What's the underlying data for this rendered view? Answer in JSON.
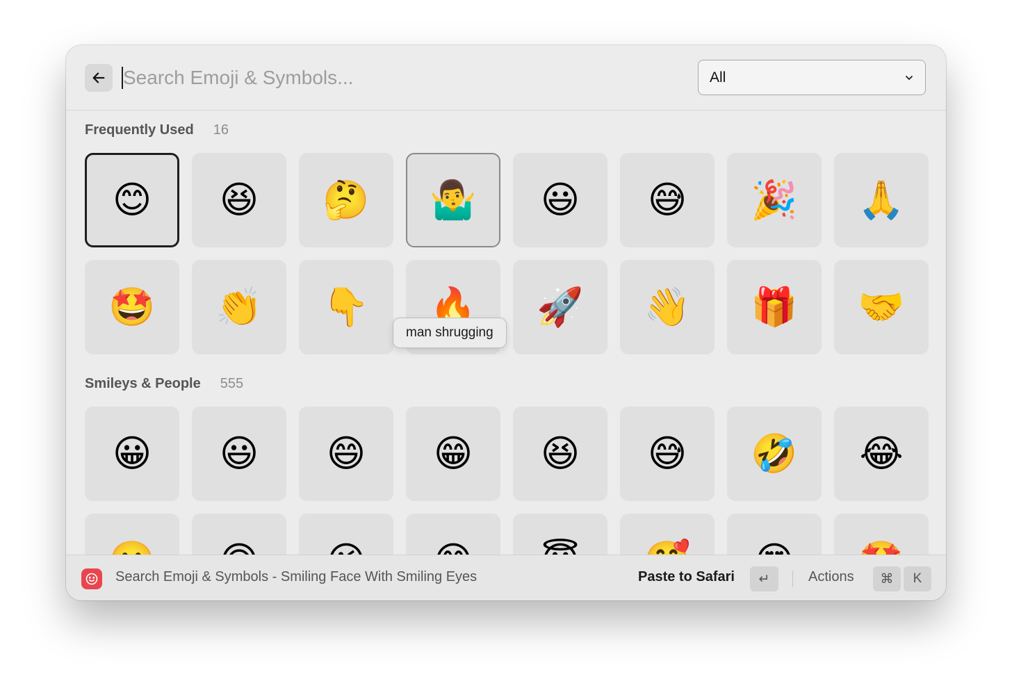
{
  "search": {
    "placeholder": "Search Emoji & Symbols..."
  },
  "filter": {
    "selected": "All",
    "icon": "chevron-down-icon"
  },
  "sections": [
    {
      "title": "Frequently Used",
      "count": "16",
      "emojis": [
        "😊",
        "😆",
        "🤔",
        "🤷‍♂️",
        "😃",
        "😅",
        "🎉",
        "🙏",
        "🤩",
        "👏",
        "👇",
        "🔥",
        "🚀",
        "👋",
        "🎁",
        "🤝"
      ]
    },
    {
      "title": "Smileys & People",
      "count": "555",
      "emojis": [
        "😀",
        "😃",
        "😄",
        "😁",
        "😆",
        "😅",
        "🤣",
        "😂",
        "🙂",
        "🙃",
        "😉",
        "😊",
        "😇",
        "🥰",
        "😍",
        "🤩"
      ]
    }
  ],
  "tooltip": {
    "text": "man shrugging"
  },
  "footer": {
    "title": "Search Emoji & Symbols - Smiling Face With Smiling Eyes",
    "primary_action": "Paste to Safari",
    "enter_key": "↵",
    "actions_label": "Actions",
    "cmd_key": "⌘",
    "k_key": "K"
  },
  "colors": {
    "app_icon": "#e8464e",
    "selected_border": "#1e1e1e",
    "cell_background": "#e0e0e0"
  }
}
